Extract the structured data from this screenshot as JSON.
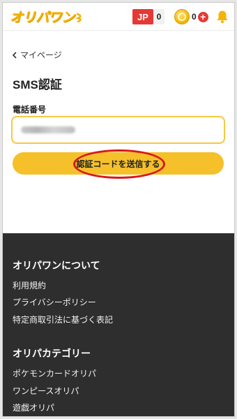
{
  "header": {
    "logo_text": "オリパワン",
    "jp_label": "JP",
    "jp_count": "0",
    "coin_count": "0",
    "plus_label": "+"
  },
  "main": {
    "breadcrumb": "マイページ",
    "title": "SMS認証",
    "phone_label": "電話番号",
    "send_button": "認証コードを送信する"
  },
  "footer": {
    "section1": {
      "heading": "オリパワンについて",
      "links": [
        "利用規約",
        "プライバシーポリシー",
        "特定商取引法に基づく表記"
      ]
    },
    "section2": {
      "heading": "オリパカテゴリー",
      "links": [
        "ポケモンカードオリパ",
        "ワンピースオリパ",
        "遊戯オリパ"
      ]
    }
  },
  "colors": {
    "accent": "#f6c02b",
    "brand_logo": "#f5b400",
    "jp_badge": "#e53935",
    "footer_bg": "#2e2e2e",
    "highlight": "#d7191c"
  },
  "icons": [
    "chevron-left-icon",
    "coin-icon",
    "plus-icon",
    "bell-icon"
  ]
}
